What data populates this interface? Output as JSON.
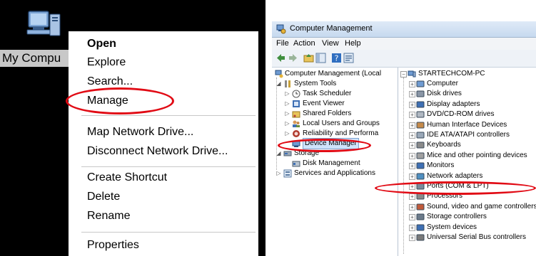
{
  "desktop": {
    "icon_name": "my-computer-icon",
    "label": "My Compu"
  },
  "context_menu": {
    "items": [
      {
        "label": "Open",
        "bold": true
      },
      {
        "label": "Explore"
      },
      {
        "label": "Search..."
      },
      {
        "label": "Manage",
        "highlighted": true
      },
      {
        "label": "Map Network Drive..."
      },
      {
        "label": "Disconnect Network Drive..."
      },
      {
        "label": "Create Shortcut"
      },
      {
        "label": "Delete"
      },
      {
        "label": "Rename"
      },
      {
        "label": "Properties"
      }
    ]
  },
  "window": {
    "title": "Computer Management",
    "menu": [
      "File",
      "Action",
      "View",
      "Help"
    ],
    "toolbar_icons": [
      "back-arrow-icon",
      "forward-arrow-icon",
      "up-folder-icon",
      "console-tree-icon",
      "help-icon",
      "properties-icon"
    ],
    "tree": [
      {
        "label": "Computer Management (Local",
        "icon": "computer-management-icon"
      },
      {
        "label": "System Tools",
        "icon": "tools-icon"
      },
      {
        "label": "Task Scheduler",
        "icon": "clock-icon"
      },
      {
        "label": "Event Viewer",
        "icon": "event-viewer-icon"
      },
      {
        "label": "Shared Folders",
        "icon": "shared-folder-icon"
      },
      {
        "label": "Local Users and Groups",
        "icon": "users-icon"
      },
      {
        "label": "Reliability and Performa",
        "icon": "performance-icon"
      },
      {
        "label": "Device Manager",
        "icon": "device-manager-icon",
        "selected": true
      },
      {
        "label": "Storage",
        "icon": "storage-icon"
      },
      {
        "label": "Disk Management",
        "icon": "disk-management-icon"
      },
      {
        "label": "Services and Applications",
        "icon": "services-icon"
      }
    ],
    "devices_root": "STARTECHCOM-PC",
    "devices": [
      {
        "label": "Computer",
        "icon": "computer-icon"
      },
      {
        "label": "Disk drives",
        "icon": "disk-drive-icon"
      },
      {
        "label": "Display adapters",
        "icon": "display-adapter-icon"
      },
      {
        "label": "DVD/CD-ROM drives",
        "icon": "dvd-icon"
      },
      {
        "label": "Human Interface Devices",
        "icon": "hid-icon"
      },
      {
        "label": "IDE ATA/ATAPI controllers",
        "icon": "ide-controller-icon"
      },
      {
        "label": "Keyboards",
        "icon": "keyboard-icon"
      },
      {
        "label": "Mice and other pointing devices",
        "icon": "mouse-icon"
      },
      {
        "label": "Monitors",
        "icon": "monitor-icon"
      },
      {
        "label": "Network adapters",
        "icon": "network-adapter-icon"
      },
      {
        "label": "Ports (COM & LPT)",
        "icon": "port-icon",
        "highlighted": true
      },
      {
        "label": "Processors",
        "icon": "processor-icon"
      },
      {
        "label": "Sound, video and game controllers",
        "icon": "sound-icon"
      },
      {
        "label": "Storage controllers",
        "icon": "storage-controller-icon"
      },
      {
        "label": "System devices",
        "icon": "system-devices-icon"
      },
      {
        "label": "Universal Serial Bus controllers",
        "icon": "usb-icon"
      }
    ]
  },
  "colors": {
    "highlight_oval": "#e10a14",
    "selection": "#cfe3fb",
    "desktop_background": "#000000"
  }
}
